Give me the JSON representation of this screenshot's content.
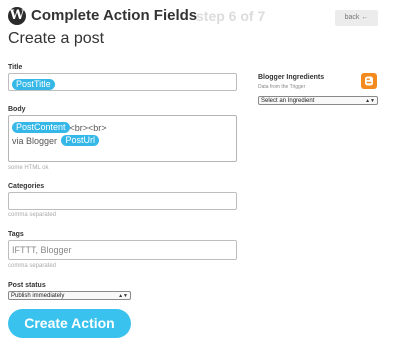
{
  "header": {
    "logo_glyph": "W",
    "title": "Complete Action Fields",
    "step": "step 6 of 7",
    "back_label": "back ←"
  },
  "page_title": "Create a post",
  "fields": {
    "title": {
      "label": "Title",
      "pills": [
        "PostTitle"
      ]
    },
    "body": {
      "label": "Body",
      "pill_content": "PostContent",
      "text_after_content": "<br><br>",
      "text_line2": "via Blogger",
      "pill_url": "PostUrl",
      "hint": "some HTML ok"
    },
    "categories": {
      "label": "Categories",
      "value": "",
      "hint": "comma separated"
    },
    "tags": {
      "label": "Tags",
      "value": "IFTTT, Blogger",
      "hint": "comma separated"
    },
    "post_status": {
      "label": "Post status",
      "selected": "Publish immediately"
    }
  },
  "ingredients": {
    "title": "Blogger Ingredients",
    "subtitle": "Data from the Trigger",
    "select_placeholder": "Select an Ingredient",
    "icon": "blogger-icon"
  },
  "create_button": "Create Action",
  "colors": {
    "pill": "#35b8e8",
    "button": "#3ac2ee",
    "blogger": "#f28a1e"
  }
}
